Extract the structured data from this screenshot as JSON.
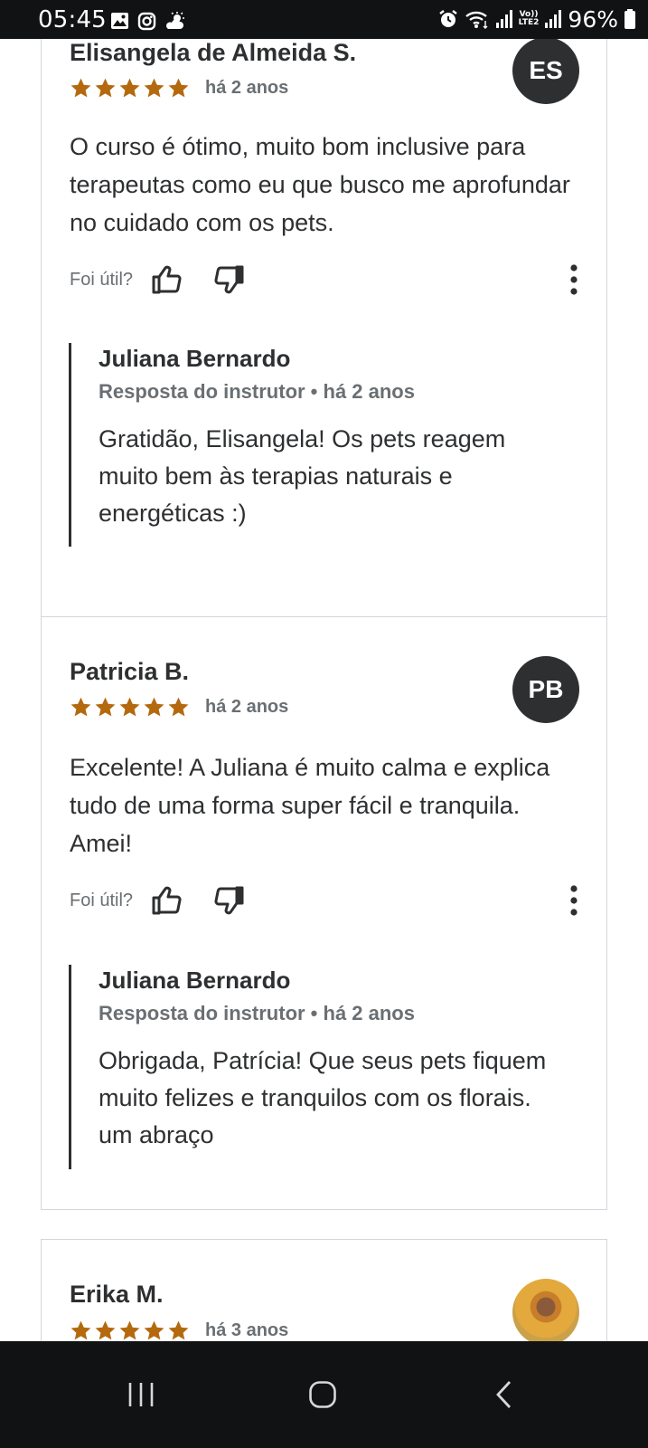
{
  "status_bar": {
    "time": "05:45",
    "battery_percent": "96%",
    "network_label_top": "Vo))",
    "network_label_bottom": "LTE2",
    "icons": [
      "gallery-icon",
      "instagram-icon",
      "weather-icon",
      "alarm-icon",
      "wifi-icon",
      "signal-icon",
      "battery-icon"
    ]
  },
  "reviews": [
    {
      "name": "Elisangela de Almeida S.",
      "initials": "ES",
      "rating": 5,
      "time": "há 2 anos",
      "text": "O curso é ótimo, muito bom inclusive para terapeutas como eu que busco me aprofundar no cuidado com os pets.",
      "helpful_label": "Foi útil?",
      "reply": {
        "name": "Juliana Bernardo",
        "meta": "Resposta do instrutor • há 2 anos",
        "text": "Gratidão, Elisangela! Os pets reagem muito bem às terapias naturais e energéticas :)"
      }
    },
    {
      "name": "Patricia B.",
      "initials": "PB",
      "rating": 5,
      "time": "há 2 anos",
      "text": "Excelente! A Juliana é muito calma e explica tudo de uma forma super fácil e tranquila. Amei!",
      "helpful_label": "Foi útil?",
      "reply": {
        "name": "Juliana Bernardo",
        "meta": "Resposta do instrutor • há 2 anos",
        "text": "Obrigada, Patrícia! Que seus pets fiquem muito felizes e tranquilos com os florais. um abraço"
      }
    },
    {
      "name": "Erika M.",
      "rating": 5,
      "time": "há 3 anos"
    }
  ],
  "colors": {
    "star": "#b4690e",
    "text_primary": "#2d2f31",
    "text_secondary": "#6a6f73",
    "card_border": "#d1d7dc",
    "system_bars": "#111214"
  },
  "nav_bar": {
    "buttons": [
      "recents-icon",
      "home-icon",
      "back-icon"
    ]
  }
}
